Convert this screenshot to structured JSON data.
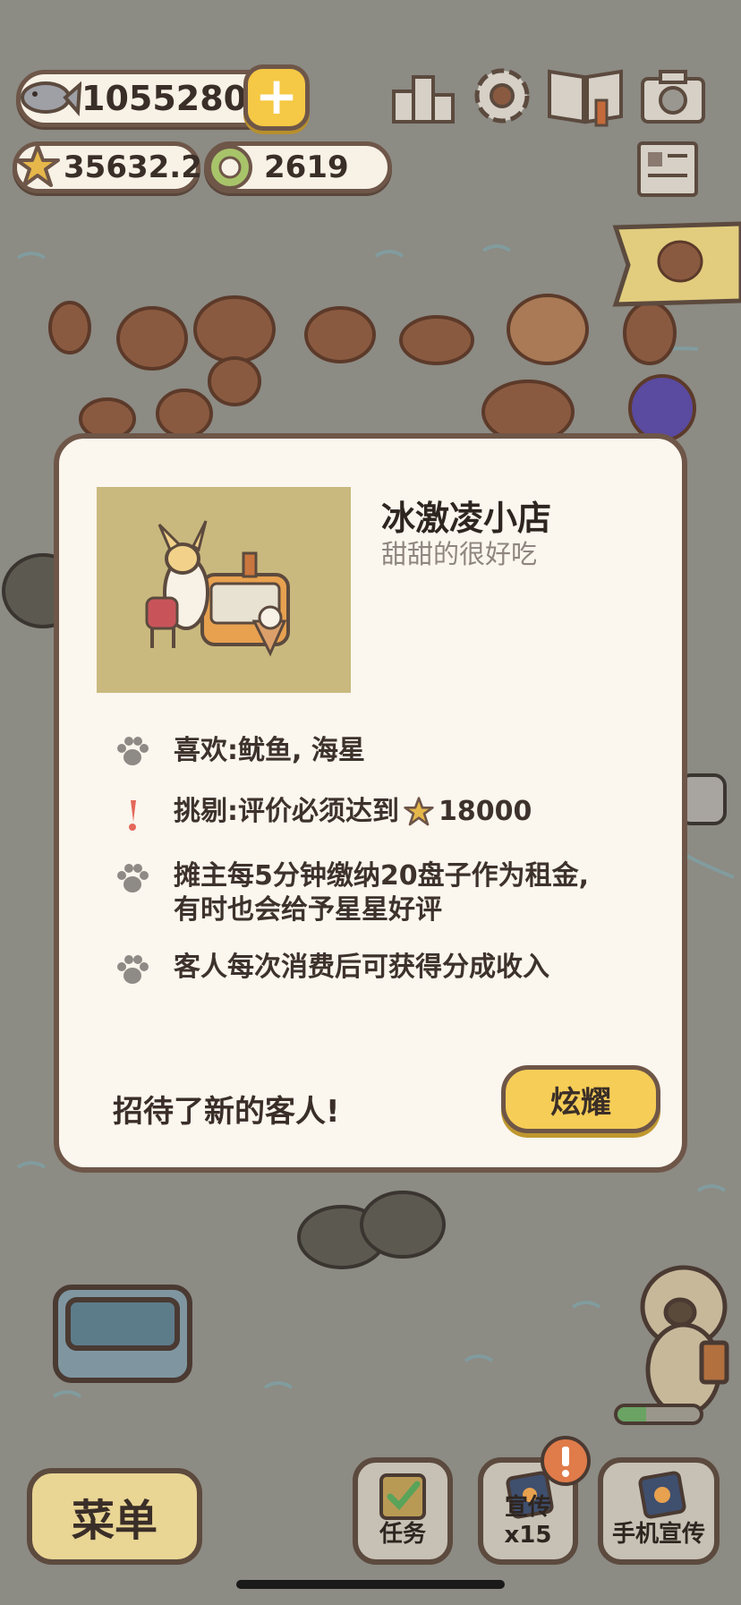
{
  "hud": {
    "fish_count": "10552808",
    "star_rating": "35632.2",
    "coin_count": "2619",
    "icons": [
      "fish-icon",
      "plus-icon",
      "star-icon",
      "coin-icon",
      "leaderboard-icon",
      "settings-gear-icon",
      "catalog-book-icon",
      "camera-icon",
      "newspaper-icon",
      "cooking-pan-icon"
    ]
  },
  "modal": {
    "title": "冰激凌小店",
    "subtitle": "甜甜的很好吃",
    "likes": "喜欢:鱿鱼, 海星",
    "picky_prefix": "挑剔:评价必须达到",
    "picky_value": "18000",
    "rent_line1": "摊主每5分钟缴纳20盘子作为租金,",
    "rent_line2": "有时也会给予星星好评",
    "revenue": "客人每次消费后可获得分成收入",
    "footer": "招待了新的客人!",
    "brag_button": "炫耀"
  },
  "bottom": {
    "menu": "菜单",
    "tasks": "任务",
    "promote": "宣传x15",
    "phone_promote": "手机宣传",
    "progress_fraction": 0.35
  },
  "colors": {
    "accent_yellow": "#f6cd56",
    "outline_brown": "#6e5648",
    "card_bg": "#fbf6ee"
  }
}
